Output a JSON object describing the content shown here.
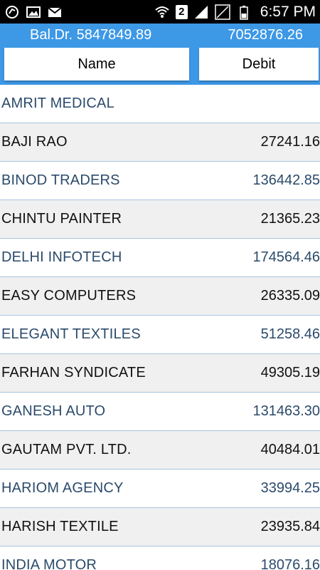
{
  "status_bar": {
    "time": "6:57 PM",
    "sim_badge": "2",
    "left_icons": [
      "sync-icon",
      "image-icon",
      "gmail-icon"
    ],
    "right_icons": [
      "wifi-icon",
      "sim-badge",
      "signal-icon",
      "signal-empty-icon",
      "battery-icon"
    ]
  },
  "header": {
    "balance_label": "Bal.Dr. 5847849.89",
    "total_value": "7052876.26",
    "accent_color": "#3d98e6"
  },
  "buttons": {
    "name_label": "Name",
    "debit_label": "Debit"
  },
  "rows": [
    {
      "name": "AMRIT MEDICAL",
      "amount": ""
    },
    {
      "name": "BAJI RAO",
      "amount": "27241.16"
    },
    {
      "name": "BINOD TRADERS",
      "amount": "136442.85"
    },
    {
      "name": "CHINTU PAINTER",
      "amount": "21365.23"
    },
    {
      "name": "DELHI INFOTECH",
      "amount": "174564.46"
    },
    {
      "name": "EASY COMPUTERS",
      "amount": "26335.09"
    },
    {
      "name": "ELEGANT TEXTILES",
      "amount": "51258.46"
    },
    {
      "name": "FARHAN SYNDICATE",
      "amount": "49305.19"
    },
    {
      "name": "GANESH AUTO",
      "amount": "131463.30"
    },
    {
      "name": "GAUTAM PVT. LTD.",
      "amount": "40484.01"
    },
    {
      "name": "HARIOM AGENCY",
      "amount": "33994.25"
    },
    {
      "name": "HARISH TEXTILE",
      "amount": "23935.84"
    },
    {
      "name": "INDIA MOTOR",
      "amount": "18076.16"
    }
  ]
}
